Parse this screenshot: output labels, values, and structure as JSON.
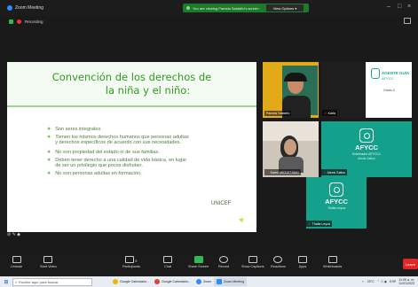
{
  "window": {
    "title": "Zoom Meeting",
    "share_banner": "You are viewing Pamela Saldaño's screen",
    "view_options": "View Options",
    "status": "Recording"
  },
  "slide": {
    "title_line1": "Convención de los derechos de",
    "title_line2": "la niña y el niño:",
    "bullets": [
      "Son seres integrales.",
      "Tienen los mismos derechos humanos que personas adultas",
      "y derechos específicos de acuerdo con sus necesidades.",
      "No son propiedad del estado ni de sus familias.",
      "Deben tener derecho a una calidad de vida básica, en lugar",
      "de ser un privilegio que pocos disfrutan.",
      "No son personas adultas en formación."
    ],
    "source": "UNICEF"
  },
  "participants": {
    "pamela": "Pamela Saldaño",
    "karla": "Karla",
    "agente_line1": "AGENTE GUÍA",
    "agente_line2": "AFYCC",
    "agente_sub": "Grado C",
    "karen": "Karen M0310715A0",
    "alexis": "Alexis Saltzo",
    "afycc_brand": "AFYCC",
    "afycc_role": "Entrenador AFYCC1",
    "afycc_person": "Alexis Saltzo",
    "thalia_brand": "AFYCC",
    "thalia_sub": "Thalia Leyva",
    "thalia_tag": "Thalia Leyva"
  },
  "toolbar": {
    "items": [
      "Unmute",
      "Start Video",
      "Participants",
      "Chat",
      "Share Screen",
      "Record",
      "Show Captions",
      "Reactions",
      "Apps",
      "Whiteboards"
    ],
    "participants_count": "5",
    "leave": "Leave"
  },
  "taskbar": {
    "search_placeholder": "Escribe aquí para buscar",
    "tasks": [
      "Google Calendario...",
      "Google Calendario...",
      "Zoom",
      "Zoom Meeting"
    ],
    "weather": "25°C",
    "lang": "ESP",
    "time": "11:09 a. m.",
    "date": "11/01/2023"
  },
  "colors": {
    "slide_green": "#2c9c1c",
    "afycc_teal": "#14a18b",
    "leave_red": "#e02828"
  }
}
